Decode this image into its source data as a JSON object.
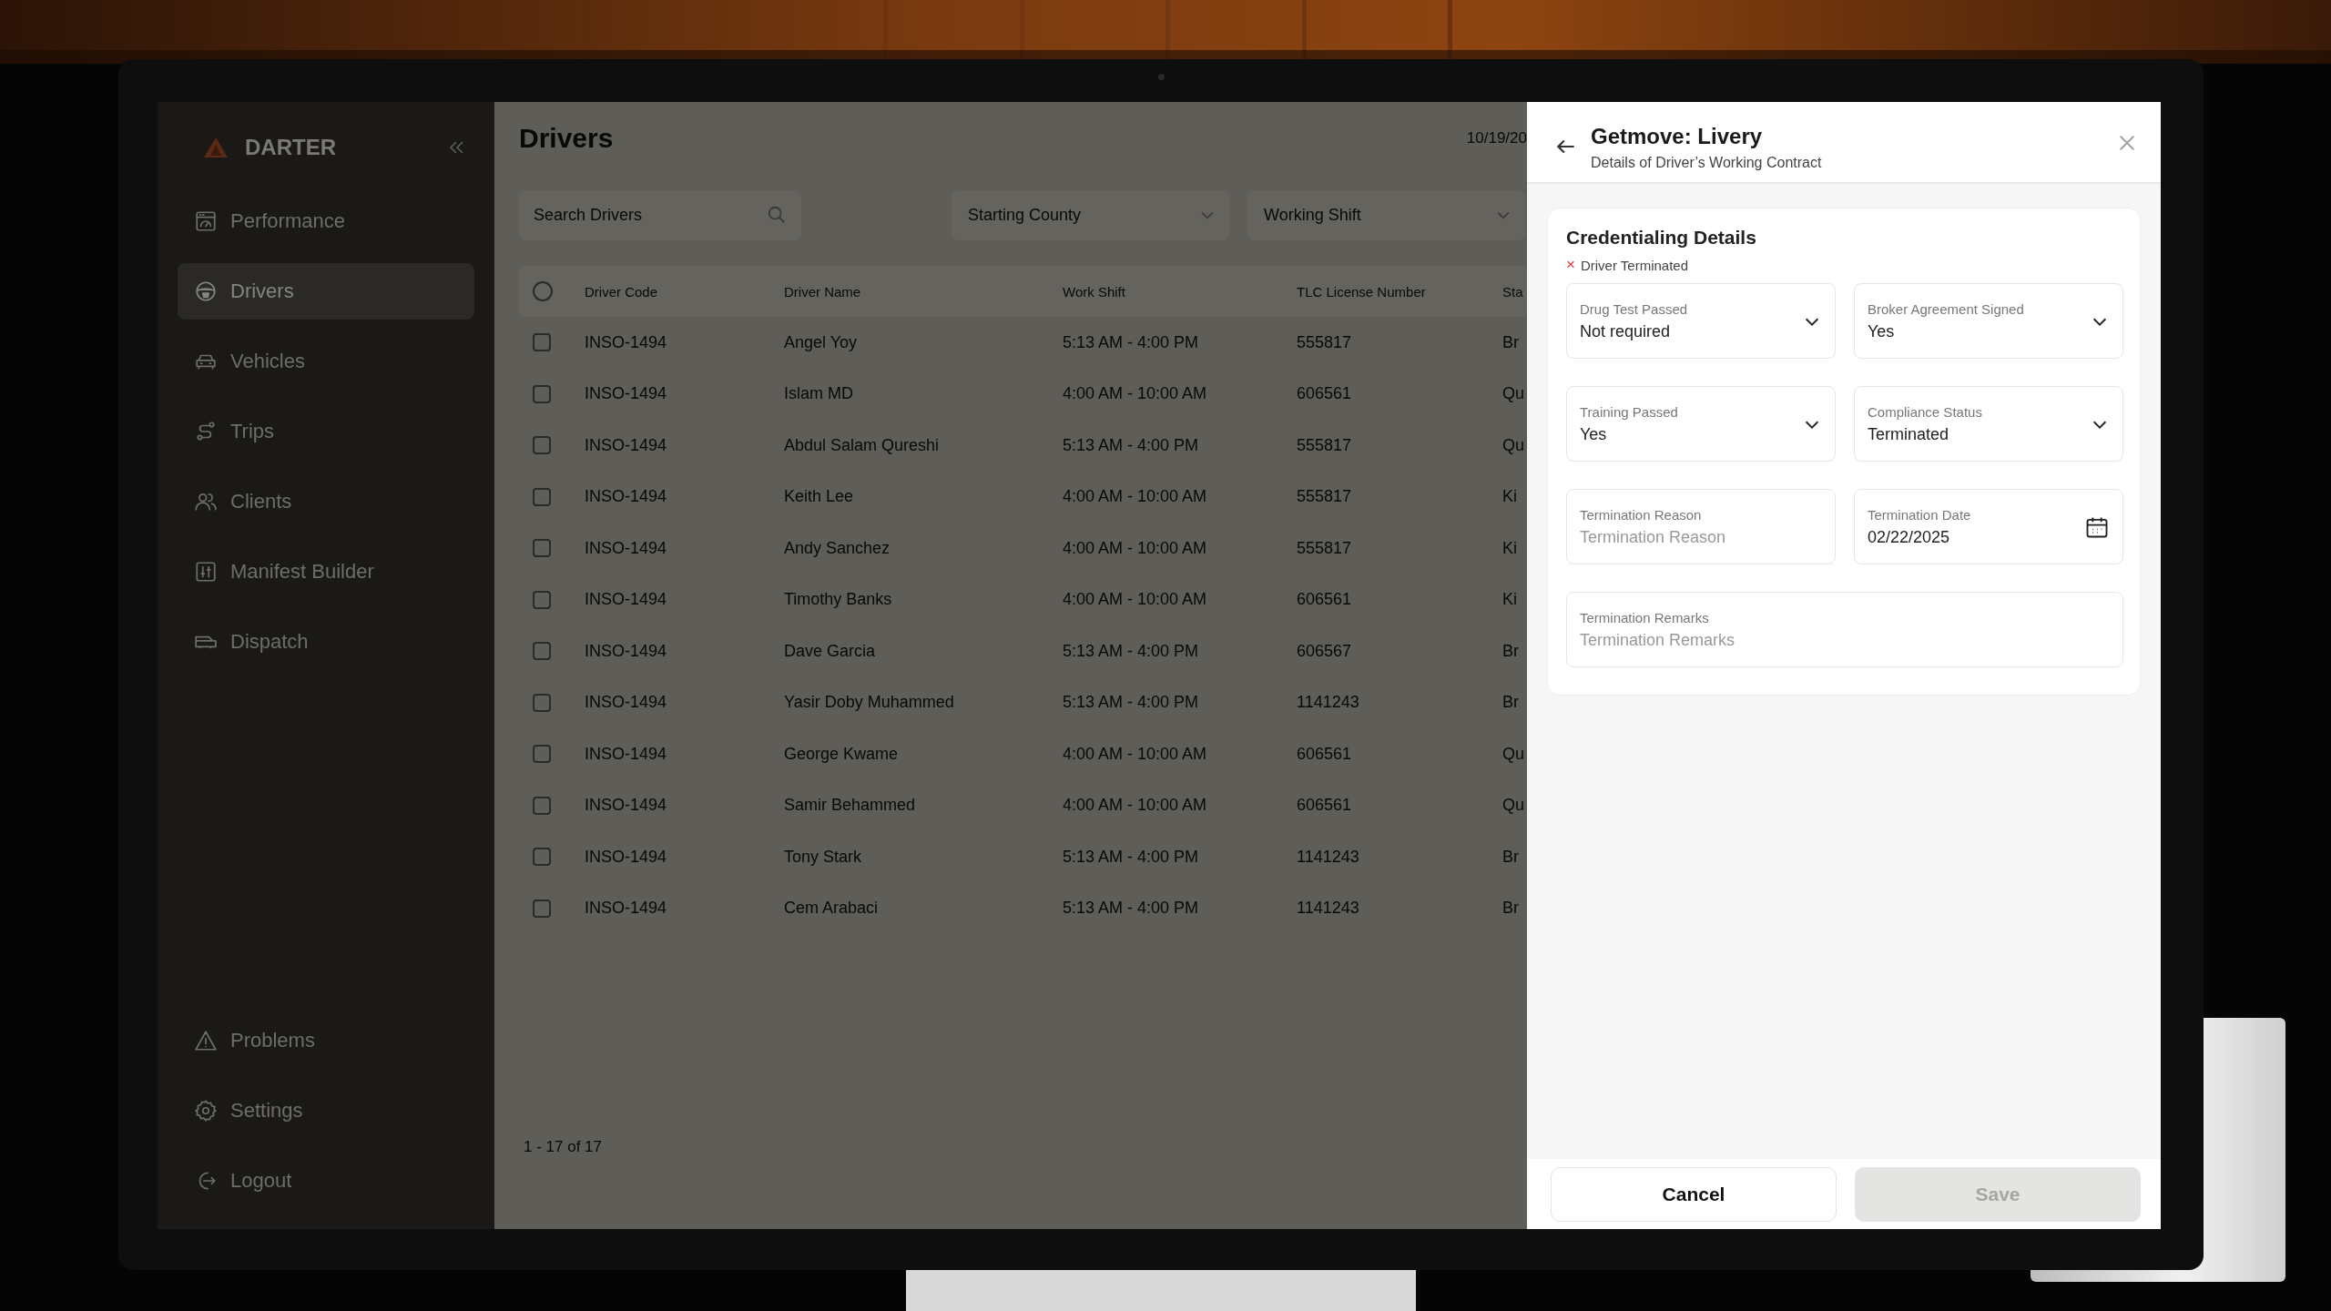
{
  "sidebar": {
    "logo": "DARTER",
    "items": [
      {
        "label": "Performance",
        "selected": false
      },
      {
        "label": "Drivers",
        "selected": true
      },
      {
        "label": "Vehicles",
        "selected": false
      },
      {
        "label": "Trips",
        "selected": false
      },
      {
        "label": "Clients",
        "selected": false
      },
      {
        "label": "Manifest Builder",
        "selected": false
      },
      {
        "label": "Dispatch",
        "selected": false
      }
    ],
    "bottom_items": [
      {
        "label": "Problems",
        "selected": false
      },
      {
        "label": "Settings",
        "selected": false
      },
      {
        "label": "Logout",
        "selected": false
      }
    ]
  },
  "main": {
    "title": "Drivers",
    "date": "10/19/20",
    "search": {
      "placeholder": "Search Drivers"
    },
    "filters": [
      {
        "placeholder": "Starting County"
      },
      {
        "placeholder": "Working Shift"
      }
    ],
    "table": {
      "select_all": {
        "checked": false
      },
      "columns": [
        "Driver Code",
        "Driver Name",
        "Work Shift",
        "TLC License Number",
        "Sta"
      ],
      "rows": [
        {
          "checked": false,
          "cells": [
            "INSO-1494",
            "Angel Yoy",
            "5:13 AM - 4:00 PM",
            "555817",
            "Br"
          ]
        },
        {
          "checked": false,
          "cells": [
            "INSO-1494",
            "Islam MD",
            "4:00 AM - 10:00 AM",
            "606561",
            "Qu"
          ]
        },
        {
          "checked": false,
          "cells": [
            "INSO-1494",
            "Abdul Salam Qureshi",
            "5:13 AM - 4:00 PM",
            "555817",
            "Qu"
          ]
        },
        {
          "checked": false,
          "cells": [
            "INSO-1494",
            "Keith Lee",
            "4:00 AM - 10:00 AM",
            "555817",
            "Ki"
          ]
        },
        {
          "checked": false,
          "cells": [
            "INSO-1494",
            "Andy Sanchez",
            "4:00 AM - 10:00 AM",
            "555817",
            "Ki"
          ]
        },
        {
          "checked": false,
          "cells": [
            "INSO-1494",
            "Timothy Banks",
            "4:00 AM - 10:00 AM",
            "606561",
            "Ki"
          ]
        },
        {
          "checked": false,
          "cells": [
            "INSO-1494",
            "Dave Garcia",
            "5:13 AM - 4:00 PM",
            "606567",
            "Br"
          ]
        },
        {
          "checked": false,
          "cells": [
            "INSO-1494",
            "Yasir Doby Muhammed",
            "5:13 AM - 4:00 PM",
            "1141243",
            "Br"
          ]
        },
        {
          "checked": false,
          "cells": [
            "INSO-1494",
            "George Kwame",
            "4:00 AM - 10:00 AM",
            "606561",
            "Qu"
          ]
        },
        {
          "checked": false,
          "cells": [
            "INSO-1494",
            "Samir Behammed",
            "4:00 AM - 10:00 AM",
            "606561",
            "Qu"
          ]
        },
        {
          "checked": false,
          "cells": [
            "INSO-1494",
            "Tony Stark",
            "5:13 AM - 4:00 PM",
            "1141243",
            "Br"
          ]
        },
        {
          "checked": false,
          "cells": [
            "INSO-1494",
            "Cem Arabaci",
            "5:13 AM - 4:00 PM",
            "1141243",
            "Br"
          ]
        }
      ]
    },
    "pagination": "1 - 17 of 17"
  },
  "panel": {
    "title": "Getmove: Livery",
    "subtitle": "Details of Driver’s Working Contract",
    "card": {
      "title": "Credentialing Details",
      "status_mark": "×",
      "status_text": "Driver Terminated",
      "fields": [
        {
          "kind": "select",
          "label": "Drug Test Passed",
          "value": "Not required"
        },
        {
          "kind": "select",
          "label": "Broker Agreement Signed",
          "value": "Yes"
        },
        {
          "kind": "select",
          "label": "Training Passed",
          "value": "Yes"
        },
        {
          "kind": "select",
          "label": "Compliance Status",
          "value": "Terminated"
        },
        {
          "kind": "text",
          "label": "Termination Reason",
          "placeholder": "Termination Reason"
        },
        {
          "kind": "date",
          "label": "Termination Date",
          "value": "02/22/2025"
        },
        {
          "kind": "textarea",
          "label": "Termination Remarks",
          "placeholder": "Termination Remarks"
        }
      ]
    },
    "buttons": [
      {
        "label": "Cancel",
        "disabled": false
      },
      {
        "label": "Save",
        "disabled": true
      }
    ]
  }
}
